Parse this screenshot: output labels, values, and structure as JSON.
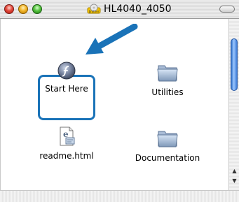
{
  "window": {
    "title": "HL4040_4050"
  },
  "icons": [
    {
      "label": "Start Here",
      "icon": "flash-installer-icon",
      "selected": true
    },
    {
      "label": "Utilities",
      "icon": "folder-icon",
      "selected": false
    },
    {
      "label": "readme.html",
      "icon": "html-document-icon",
      "selected": false
    },
    {
      "label": "Documentation",
      "icon": "folder-icon",
      "selected": false
    }
  ],
  "colors": {
    "selection_border": "#1a73b8",
    "arrow": "#1a73b8"
  }
}
